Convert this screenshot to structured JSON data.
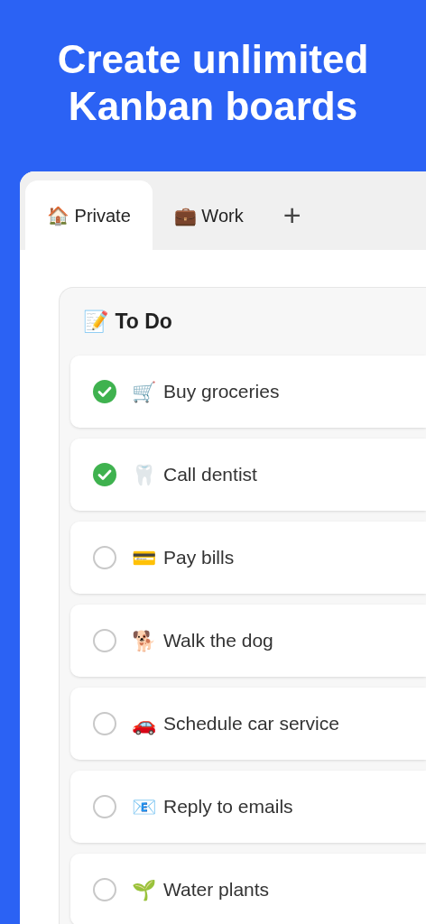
{
  "headline": "Create unlimited Kanban boards",
  "tabs": [
    {
      "label": "🏠 Private",
      "selected": true
    },
    {
      "label": "💼 Work",
      "selected": false
    }
  ],
  "add_tab": "+",
  "column": {
    "title": "📝 To Do",
    "tasks": [
      {
        "icon": "🛒",
        "label": "Buy groceries",
        "checked": true
      },
      {
        "icon": "🦷",
        "label": "Call dentist",
        "checked": true
      },
      {
        "icon": "💳",
        "label": "Pay bills",
        "checked": false
      },
      {
        "icon": "🐕",
        "label": "Walk the dog",
        "checked": false
      },
      {
        "icon": "🚗",
        "label": "Schedule car service",
        "checked": false
      },
      {
        "icon": "📧",
        "label": "Reply to emails",
        "checked": false
      },
      {
        "icon": "🌱",
        "label": "Water plants",
        "checked": false
      }
    ]
  }
}
